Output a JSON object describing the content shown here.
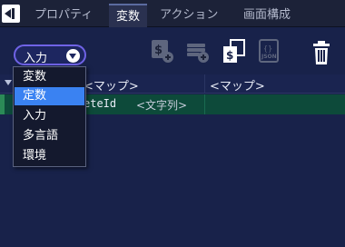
{
  "tabs": [
    {
      "label": "プロパティ"
    },
    {
      "label": "変数"
    },
    {
      "label": "アクション"
    },
    {
      "label": "画面構成"
    }
  ],
  "active_tab": "変数",
  "toolbar": {
    "mode_value": "入力",
    "tools": [
      "add-variable-icon",
      "add-data-icon",
      "copy-variable-icon",
      "json-icon",
      "trash-icon"
    ]
  },
  "grid": {
    "headers": [
      "<マップ>",
      "<マップ>"
    ],
    "row": {
      "id_partial": "eteId",
      "type": "<文字列>"
    }
  },
  "dropdown": {
    "options": [
      "変数",
      "定数",
      "入力",
      "多言語",
      "環境"
    ],
    "selected": "定数"
  },
  "colors": {
    "background": "#18224a",
    "accent": "#6f63e6",
    "selection": "#3a82f2",
    "row_highlight": "#0d4a3a"
  }
}
